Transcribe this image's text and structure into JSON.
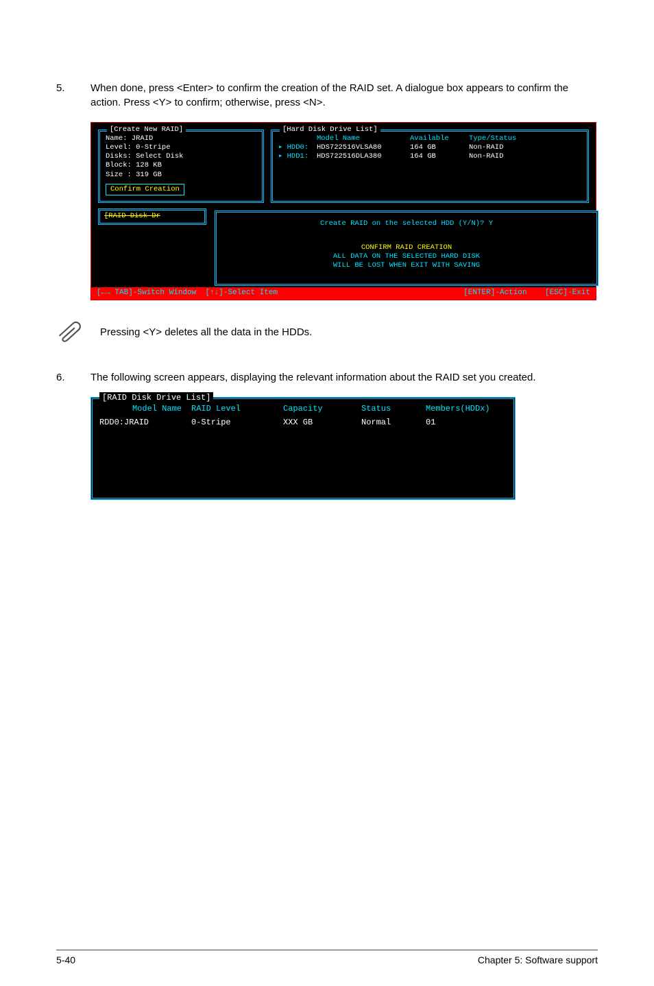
{
  "step5": {
    "num": "5.",
    "text": "When done, press <Enter> to confirm the creation of the RAID set. A dialogue box appears to confirm the action. Press <Y> to confirm; otherwise, press <N>."
  },
  "bios1": {
    "create_title": "[Create New RAID]",
    "hdd_title": "[Hard Disk Drive List]",
    "lines": {
      "name": "Name: JRAID",
      "level": "Level: 0-Stripe",
      "disks": "Disks: Select Disk",
      "block": "Block: 128 KB",
      "size": "Size : 319 GB"
    },
    "confirm_btn": "Confirm Creation",
    "hdd_head": {
      "model": "Model Name",
      "avail": "Available",
      "type": "Type/Status"
    },
    "hdd_rows": [
      {
        "idx": "▸ HDD0:",
        "model": "HDS722516VLSA80",
        "avail": "164 GB",
        "type": "Non-RAID"
      },
      {
        "idx": "▸ HDD1:",
        "model": "HDS722516DLA380",
        "avail": "164 GB",
        "type": "Non-RAID"
      }
    ],
    "raid_disk_partial": "[RAID Disk Dr",
    "dialog": {
      "prompt": "Create RAID on the selected HDD (Y/N)? Y",
      "warnhead": "CONFIRM RAID CREATION",
      "warn1": "ALL DATA ON THE SELECTED HARD DISK",
      "warn2": "WILL BE LOST WHEN EXIT WITH SAVING"
    },
    "footer": {
      "a": "[←→ TAB]-Switch Window",
      "b": "[↑↓]-Select Item",
      "c": "[ENTER]-Action",
      "d": "[ESC]-Exit"
    }
  },
  "note": {
    "text": "Pressing <Y> deletes all the data in the HDDs."
  },
  "step6": {
    "num": "6.",
    "text": "The following screen appears, displaying the relevant information about the RAID set you created."
  },
  "bios2": {
    "title": "[RAID Disk Drive List]",
    "head": {
      "c1": "Model Name",
      "c2": "RAID Level",
      "c3": "Capacity",
      "c4": "Status",
      "c5": "Members(HDDx)"
    },
    "row": {
      "c1": "RDD0:JRAID",
      "c2": "0-Stripe",
      "c3": "XXX GB",
      "c4": "Normal",
      "c5": "01"
    }
  },
  "footer_page": {
    "left": "5-40",
    "right": "Chapter 5: Software support"
  }
}
